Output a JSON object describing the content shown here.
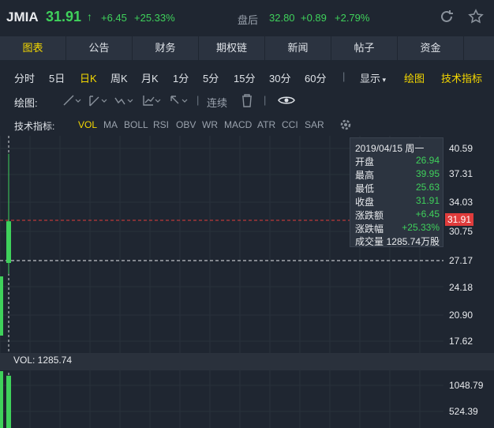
{
  "header": {
    "symbol": "JMIA",
    "price": "31.91",
    "arrow": "↑",
    "change": "+6.45",
    "change_pct": "+25.33%",
    "after_hours_label": "盘后",
    "after_hours_price": "32.80",
    "after_hours_change": "+0.89",
    "after_hours_pct": "+2.79%",
    "refresh_icon": "refresh-icon",
    "star_icon": "star-icon"
  },
  "tabs": [
    {
      "label": "图表",
      "active": true
    },
    {
      "label": "公告"
    },
    {
      "label": "财务"
    },
    {
      "label": "期权链"
    },
    {
      "label": "新闻"
    },
    {
      "label": "帖子"
    },
    {
      "label": "资金"
    },
    {
      "label": ""
    }
  ],
  "periods": [
    "分时",
    "5日",
    "日K",
    "周K",
    "月K",
    "1分",
    "5分",
    "15分",
    "30分",
    "60分"
  ],
  "period_active": "日K",
  "period_right": {
    "display": "显示",
    "draw": "绘图",
    "tech": "技术指标"
  },
  "drawing": {
    "label": "绘图:",
    "continuous": "连续"
  },
  "indicators": {
    "label": "技术指标:",
    "items": [
      "VOL",
      "MA",
      "BOLL",
      "RSI",
      "OBV",
      "WR",
      "MACD",
      "ATR",
      "CCI",
      "SAR"
    ],
    "active": "VOL"
  },
  "chart_data": {
    "type": "bar",
    "price_axis": [
      "40.59",
      "37.31",
      "34.03",
      "30.75",
      "27.17",
      "24.18",
      "20.90",
      "17.62"
    ],
    "current_price_tag": "31.91",
    "crosshair_price": "27.17",
    "volume_label": "VOL: 1285.74",
    "volume_axis": [
      "1048.79",
      "524.39"
    ],
    "candles": [
      {
        "date": "2019/04/15",
        "open": 26.94,
        "high": 39.95,
        "low": 25.63,
        "close": 31.91,
        "volume": 1285.74
      }
    ]
  },
  "tooltip": {
    "date": "2019/04/15 周一",
    "rows": [
      {
        "k": "开盘",
        "v": "26.94"
      },
      {
        "k": "最高",
        "v": "39.95"
      },
      {
        "k": "最低",
        "v": "25.63"
      },
      {
        "k": "收盘",
        "v": "31.91"
      },
      {
        "k": "涨跌额",
        "v": "+6.45"
      },
      {
        "k": "涨跌幅",
        "v": "+25.33%"
      },
      {
        "k": "成交量",
        "v": "1285.74万股"
      }
    ]
  },
  "colors": {
    "up": "#3fd15b",
    "down": "#e03c3c",
    "accent": "#f5d800"
  }
}
